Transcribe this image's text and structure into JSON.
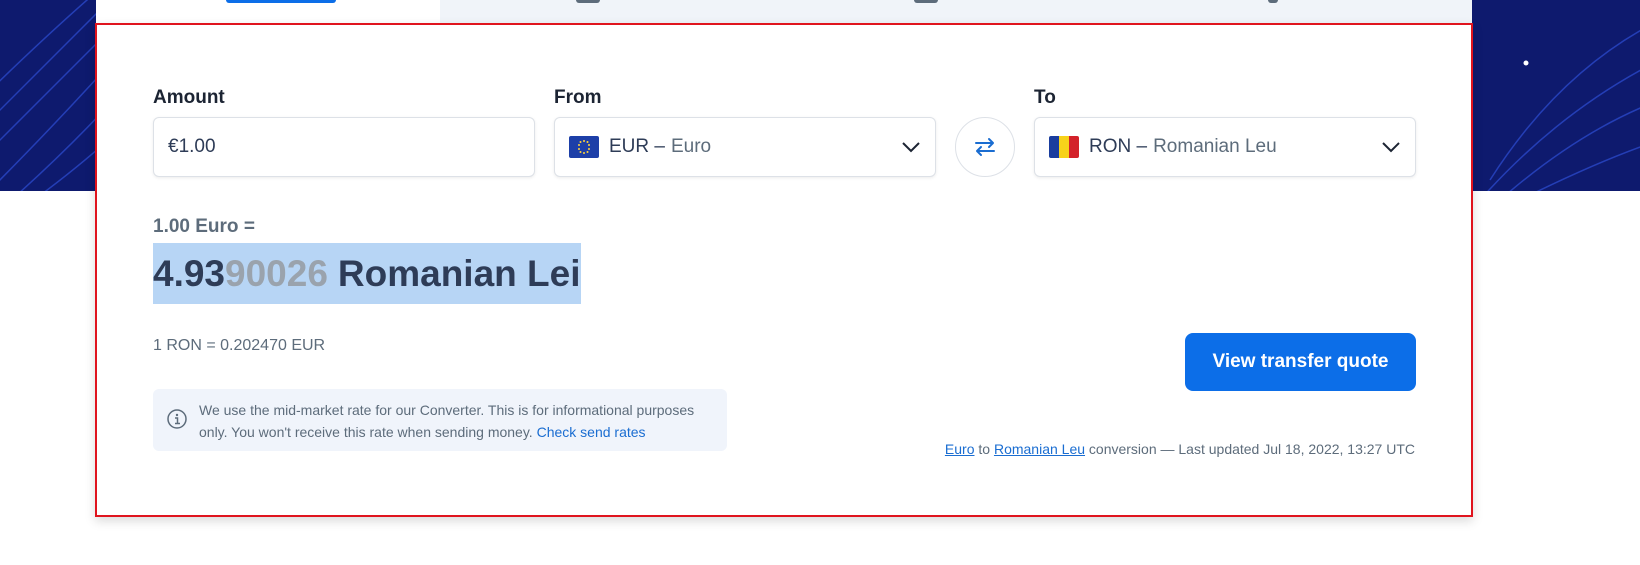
{
  "converter": {
    "amount_label": "Amount",
    "amount_value": "€1.00",
    "from_label": "From",
    "from_code": "EUR –",
    "from_name": "Euro",
    "to_label": "To",
    "to_code": "RON –",
    "to_name": "Romanian Leu",
    "swap_icon": "swap-arrows-icon"
  },
  "result": {
    "lead": "1.00 Euro =",
    "value_main": "4.93",
    "value_dim": "90026",
    "unit": "Romanian Lei",
    "inverse": "1 RON = 0.202470 EUR"
  },
  "info": {
    "text": "We use the mid-market rate for our Converter. This is for informational purposes only. You won't receive this rate when sending money.",
    "link": "Check send rates"
  },
  "actions": {
    "quote_button": "View transfer quote"
  },
  "footnote": {
    "from_link": "Euro",
    "to_word": "to",
    "to_link": "Romanian Leu",
    "rest": "conversion — Last updated Jul 18, 2022, 13:27 UTC"
  },
  "colors": {
    "accent": "#0c6ee8",
    "highlight": "#b7d5f5",
    "hero": "#0e1a6e",
    "border": "#e0141e"
  }
}
